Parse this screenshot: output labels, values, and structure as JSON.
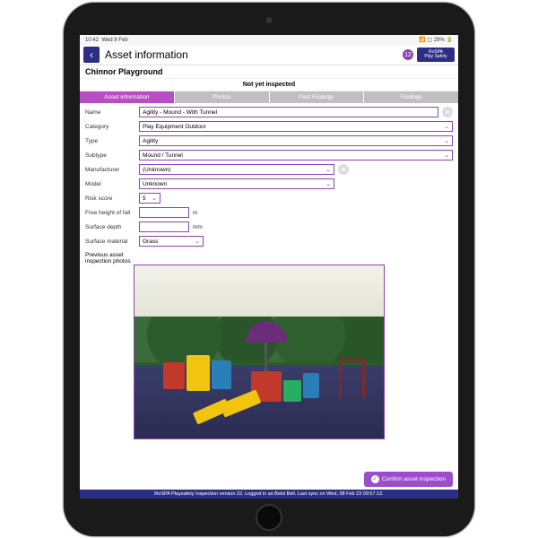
{
  "statusbar": {
    "time": "10:42",
    "date": "Wed 8 Feb",
    "battery": "29%"
  },
  "header": {
    "title": "Asset information",
    "badge": "12",
    "logo_line1": "RoSPA",
    "logo_line2": "Play Safety"
  },
  "subheader": {
    "asset_name": "Chinnor Playground"
  },
  "status_text": "Not yet inspected",
  "tabs": {
    "t1": "Asset information",
    "t2": "Photos",
    "t3": "Past Findings",
    "t4": "Findings"
  },
  "form": {
    "labels": {
      "name": "Name",
      "category": "Category",
      "type": "Type",
      "subtype": "Subtype",
      "manufacturer": "Manufacturer",
      "model": "Model",
      "risk": "Risk score",
      "freefall": "Free height of fall",
      "depth": "Surface depth",
      "material": "Surface material",
      "photos": "Previous asset inspection photos"
    },
    "values": {
      "name": "Agility - Mound - With Tunnel",
      "category": "Play Equipment Outdoor",
      "type": "Agility",
      "subtype": "Mound / Tunnel",
      "manufacturer": "(Unknown)",
      "model": "Unknown",
      "risk": "5",
      "freefall": "",
      "depth": "",
      "material": "Grass"
    },
    "units": {
      "m": "m",
      "mm": "mm"
    }
  },
  "confirm_label": "Confirm asset inspection",
  "footer": "RoSPA Playsafety Inspection version 22. Logged in as Bekii Bell. Last sync on Wed, 08 Feb 23 09:57:12."
}
